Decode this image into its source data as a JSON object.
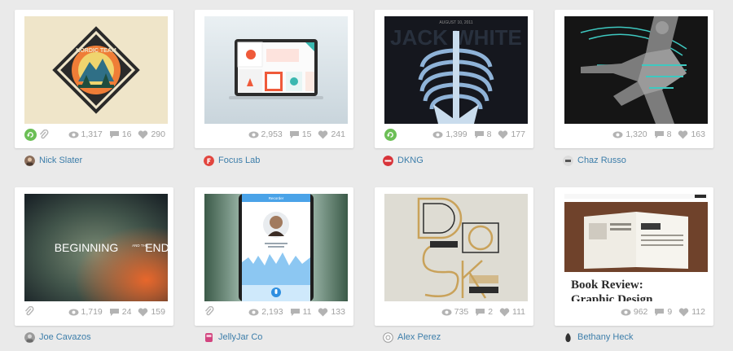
{
  "shots": [
    {
      "views": "1,317",
      "comments": "16",
      "likes": "290",
      "author": "Nick Slater",
      "rebound": true,
      "attachment": true,
      "thumb_text": [
        "NORDIC TEAM",
        "LANDS OF THE MIDNIGHT SUN"
      ],
      "avatar_color": "#8a6d5a"
    },
    {
      "views": "2,953",
      "comments": "15",
      "likes": "241",
      "author": "Focus Lab",
      "rebound": false,
      "attachment": false,
      "thumb_text": [],
      "avatar_color": "#e2463f"
    },
    {
      "views": "1,399",
      "comments": "8",
      "likes": "177",
      "author": "DKNG",
      "rebound": true,
      "attachment": false,
      "thumb_text": [
        "JACK WHITE",
        "AUGUST 10, 2011"
      ],
      "avatar_color": "#d8343a"
    },
    {
      "views": "1,320",
      "comments": "8",
      "likes": "163",
      "author": "Chaz Russo",
      "rebound": false,
      "attachment": false,
      "thumb_text": [],
      "avatar_color": "#bbbbbb"
    },
    {
      "views": "1,719",
      "comments": "24",
      "likes": "159",
      "author": "Joe Cavazos",
      "rebound": false,
      "attachment": true,
      "thumb_text": [
        "BEGINNING",
        "AND THE",
        "END"
      ],
      "avatar_color": "#9a9a9a"
    },
    {
      "views": "2,193",
      "comments": "11",
      "likes": "133",
      "author": "JellyJar Co",
      "rebound": false,
      "attachment": true,
      "thumb_text": [
        "Recorder"
      ],
      "avatar_color": "#d2457f"
    },
    {
      "views": "735",
      "comments": "2",
      "likes": "111",
      "author": "Alex Perez",
      "rebound": false,
      "attachment": false,
      "thumb_text": [],
      "avatar_color": "#ffffff"
    },
    {
      "views": "962",
      "comments": "9",
      "likes": "112",
      "author": "Bethany Heck",
      "rebound": false,
      "attachment": false,
      "thumb_text": [
        "Book Review:",
        "Graphic Design"
      ],
      "avatar_color": "#333333"
    }
  ],
  "colors": {
    "link": "#3d7eaa",
    "rebound": "#6cbf56",
    "stat": "#a0a0a0",
    "page": "#eaeaea"
  },
  "icons": {
    "views": "eye-icon",
    "comments": "comment-icon",
    "likes": "heart-icon",
    "rebound": "rebound-icon",
    "attachment": "paperclip-icon"
  }
}
